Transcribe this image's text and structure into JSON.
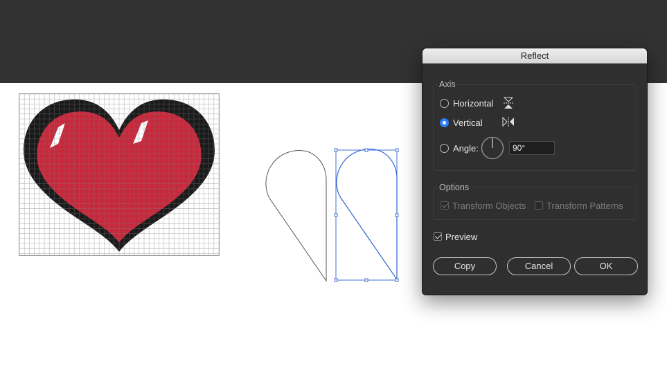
{
  "dialog": {
    "title": "Reflect",
    "axis_group": {
      "label": "Axis",
      "options": [
        {
          "label": "Horizontal",
          "selected": false,
          "icon": "reflect-horizontal-icon"
        },
        {
          "label": "Vertical",
          "selected": true,
          "icon": "reflect-vertical-icon"
        },
        {
          "label": "Angle:",
          "selected": false,
          "icon": "angle-dial-icon"
        }
      ],
      "angle_value": "90°"
    },
    "options_group": {
      "label": "Options",
      "transform_objects": {
        "label": "Transform Objects",
        "checked": true,
        "disabled": true
      },
      "transform_patterns": {
        "label": "Transform Patterns",
        "checked": false,
        "disabled": true
      }
    },
    "preview": {
      "label": "Preview",
      "checked": true
    },
    "buttons": {
      "copy": "Copy",
      "cancel": "Cancel",
      "ok": "OK"
    }
  },
  "colors": {
    "heart_red": "#c8283c",
    "heart_outline": "#1a1a1a",
    "selection_blue": "#3d6fd6",
    "accent_blue": "#2f7df7"
  }
}
